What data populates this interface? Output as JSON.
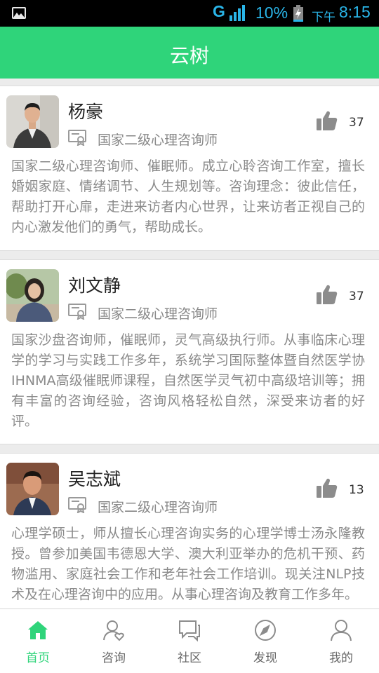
{
  "status_bar": {
    "network": "G",
    "battery_percent": "10%",
    "ampm": "下午",
    "time": "8:15",
    "color": "#2ab5e8"
  },
  "header": {
    "title": "云树",
    "color": "#2fd47a"
  },
  "counselors": [
    {
      "name": "杨豪",
      "certification": "国家二级心理咨询师",
      "likes": "37",
      "description": "国家二级心理咨询师、催眠师。成立心聆咨询工作室，擅长婚姻家庭、情绪调节、人生规划等。咨询理念：彼此信任，帮助打开心扉，走进来访者内心世界，让来访者正视自己的内心激发他们的勇气，帮助成长。"
    },
    {
      "name": "刘文静",
      "certification": "国家二级心理咨询师",
      "likes": "37",
      "description": "国家沙盘咨询师，催眠师，灵气高级执行师。从事临床心理学的学习与实践工作多年，系统学习国际整体暨自然医学协IHNMA高级催眠师课程，自然医学灵气初中高级培训等；拥有丰富的咨询经验，咨询风格轻松自然，深受来访者的好评。"
    },
    {
      "name": "吴志斌",
      "certification": "国家二级心理咨询师",
      "likes": "13",
      "description": "心理学硕士，师从擅长心理咨询实务的心理学博士汤永隆教授。曾参加美国韦德恩大学、澳大利亚举办的危机干预、药物滥用、家庭社会工作和老年社会工作培训。现关注NLP技术及在心理咨询中的应用。从事心理咨询及教育工作多年。"
    }
  ],
  "bottom_nav": [
    {
      "label": "首页",
      "icon": "home-icon",
      "active": true
    },
    {
      "label": "咨询",
      "icon": "consult-user-icon",
      "active": false
    },
    {
      "label": "社区",
      "icon": "community-chat-icon",
      "active": false
    },
    {
      "label": "发现",
      "icon": "compass-icon",
      "active": false
    },
    {
      "label": "我的",
      "icon": "profile-icon",
      "active": false
    }
  ]
}
